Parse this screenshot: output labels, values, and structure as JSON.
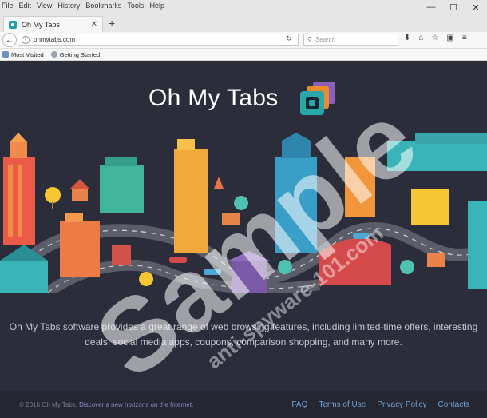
{
  "browser": {
    "menu": [
      "File",
      "Edit",
      "View",
      "History",
      "Bookmarks",
      "Tools",
      "Help"
    ],
    "window_controls": [
      "—",
      "☐",
      "✕"
    ],
    "tab_title": "Oh My Tabs",
    "tab_close": "✕",
    "new_tab": "+",
    "url": "ohmytabs.com",
    "search_placeholder": "Search",
    "bookmarks": [
      "Most Visited",
      "Getting Started"
    ]
  },
  "page": {
    "logo_text": "Oh My Tabs",
    "description_line1": "Oh My Tabs software provides a great range of web browsing features, including limited-time offers, interesting",
    "description_line2": "deals, social media apps, coupons, comparison shopping, and many more.",
    "footer": {
      "copyright": "© 2016 Oh My Tabs.",
      "tagline": "Discover a new horizons on the Internet.",
      "links": [
        "FAQ",
        "Terms of Use",
        "Privacy Policy",
        "Contacts"
      ]
    }
  },
  "watermark": {
    "main": "Sample",
    "sub": "anti-spyware-101.com"
  },
  "colors": {
    "page_bg": "#2b2d3a",
    "footer_bg": "#25262f",
    "accent_teal": "#1fa3a8",
    "link": "#6ea2d9"
  }
}
